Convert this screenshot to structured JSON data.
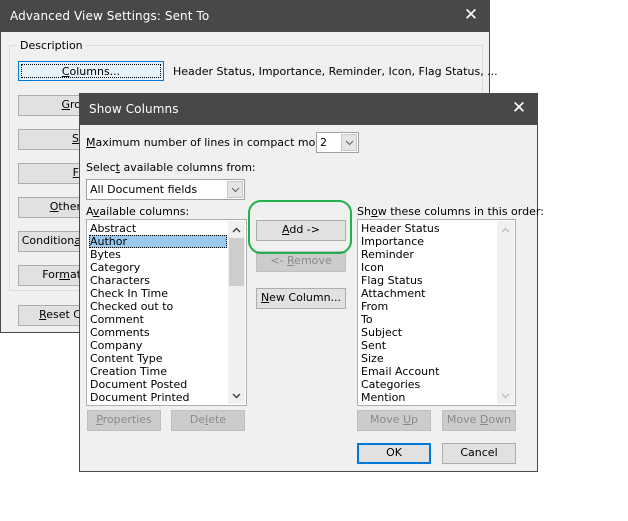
{
  "back_dialog": {
    "title": "Advanced View Settings: Sent To",
    "close_icon": "close-icon",
    "group_label": "Description",
    "columns_button": {
      "pre": "",
      "u": "C",
      "post": "olumns..."
    },
    "columns_summary": "Header Status, Importance, Reminder, Icon, Flag Status, ...",
    "group_by_button": {
      "pre": "",
      "u": "G",
      "post": "ro"
    },
    "sort_button": {
      "pre": "",
      "u": "S",
      "post": ""
    },
    "filter_button": {
      "pre": "",
      "u": "F",
      "post": ""
    },
    "other_button": {
      "pre": "",
      "u": "O",
      "post": "ther"
    },
    "conditional_button": {
      "pre": "Condition",
      "u": "a",
      "post": ""
    },
    "format_button": {
      "pre": "For",
      "u": "m",
      "post": "at"
    },
    "reset_button": {
      "pre": "",
      "u": "R",
      "post": "eset C"
    }
  },
  "show_columns": {
    "title": "Show Columns",
    "close_icon": "close-icon",
    "max_lines_label": {
      "pre": "",
      "u": "M",
      "post": "aximum number of lines in compact mode:"
    },
    "max_lines_value": "2",
    "select_from_label": {
      "pre": "Selec",
      "u": "t",
      "post": " available columns from:"
    },
    "select_from_value": "All Document fields",
    "available_label": {
      "pre": "A",
      "u": "v",
      "post": "ailable columns:"
    },
    "available_columns": [
      "Abstract",
      "Author",
      "Bytes",
      "Category",
      "Characters",
      "Check In Time",
      "Checked out to",
      "Comment",
      "Comments",
      "Company",
      "Content Type",
      "Creation Time",
      "Document Posted",
      "Document Printed"
    ],
    "selected_available": "Author",
    "add_button": {
      "pre": "",
      "u": "A",
      "post": "dd ->"
    },
    "remove_button": {
      "pre": "<- ",
      "u": "R",
      "post": "emove"
    },
    "new_column_button": {
      "pre": "",
      "u": "N",
      "post": "ew Column..."
    },
    "shown_label": {
      "pre": "Sh",
      "u": "o",
      "post": "w these columns in this order:"
    },
    "shown_columns": [
      "Header Status",
      "Importance",
      "Reminder",
      "Icon",
      "Flag Status",
      "Attachment",
      "From",
      "To",
      "Subject",
      "Sent",
      "Size",
      "Email Account",
      "Categories",
      "Mention"
    ],
    "properties_button": {
      "pre": "",
      "u": "P",
      "post": "roperties"
    },
    "delete_button": {
      "pre": "De",
      "u": "l",
      "post": "ete"
    },
    "move_up_button": {
      "pre": "Move ",
      "u": "U",
      "post": "p"
    },
    "move_down_button": {
      "pre": "Move ",
      "u": "D",
      "post": "own"
    },
    "ok_button": "OK",
    "cancel_button": "Cancel"
  },
  "annotation": {
    "highlight_color": "#22b14c",
    "target": "add_button"
  },
  "colors": {
    "titlebar": "#4a4846",
    "dialog_bg": "#f0f0f0",
    "selection": "#99c9ef",
    "focus_border": "#0078d7"
  }
}
